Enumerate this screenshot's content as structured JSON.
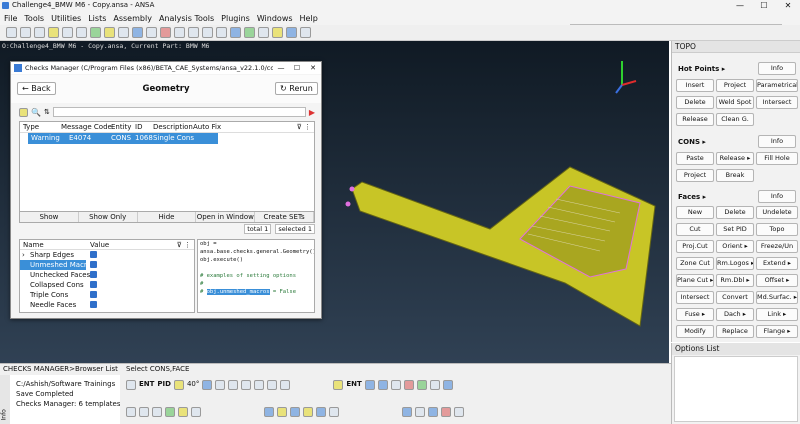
{
  "window": {
    "title": "Challenge4_BMW M6 - Copy.ansa - ANSA",
    "controls": [
      "—",
      "☐",
      "✕"
    ]
  },
  "menu": [
    "File",
    "Tools",
    "Utilities",
    "Lists",
    "Assembly",
    "Analysis Tools",
    "Plugins",
    "Windows",
    "Help"
  ],
  "status_path": "O:Challenge4_BMW M6 - Copy.ansa,  Current Part: BMW M6",
  "dialog": {
    "title": "Checks Manager (C/Program Files (x86)/BETA_CAE_Systems/ansa_v22.1.0/config/Checks/CFD_Temp...",
    "back_label": "Back",
    "heading": "Geometry",
    "rerun_label": "Rerun",
    "table": {
      "columns": [
        "Type",
        "Message Code",
        "Entity",
        "ID",
        "Description",
        "Auto Fix"
      ],
      "rows": [
        {
          "type": "Warning",
          "code": "E4074",
          "entity": "CONS",
          "id": "1068",
          "description": "Single Cons"
        }
      ]
    },
    "buttons": [
      "Show",
      "Show Only",
      "Hide",
      "Open in Window",
      "Create SETs"
    ],
    "totals": {
      "total": "total 1",
      "selected": "selected 1"
    },
    "list": {
      "name_header": "Name",
      "value_header": "Value",
      "items": [
        {
          "name": "Sharp Edges",
          "selected": false
        },
        {
          "name": "Unmeshed Macros",
          "selected": true
        },
        {
          "name": "Unchecked Faces",
          "selected": false
        },
        {
          "name": "Collapsed Cons",
          "selected": false
        },
        {
          "name": "Triple Cons",
          "selected": false
        },
        {
          "name": "Needle Faces",
          "selected": false
        }
      ]
    },
    "code": {
      "l1": "obj =",
      "l2": "ansa.base.checks.general.Geometry()",
      "l3": "obj.execute()",
      "l4": "# examples of setting options",
      "l5": "#",
      "l6a": "#",
      "l6b": "obj.unmeshed_macros",
      "l6c": " = False"
    }
  },
  "topo": {
    "title": "TOPO",
    "hotpoints": {
      "label": "Hot Points ▸",
      "buttons": [
        "Info",
        "Insert",
        "Project",
        "Parametrical",
        "Delete",
        "Weld Spot",
        "Intersect",
        "Release",
        "Clean G."
      ]
    },
    "cons": {
      "label": "CONS ▸",
      "buttons": [
        "Info",
        "Paste",
        "Release ▸",
        "Fill Hole",
        "Project",
        "Break"
      ]
    },
    "faces": {
      "label": "Faces ▸",
      "buttons": [
        "Info",
        "New",
        "Delete",
        "Undelete",
        "Cut",
        "Set PID",
        "Topo",
        "Proj.Cut",
        "Orient ▸",
        "Freeze/Un",
        "Zone Cut",
        "Rm.Logos ▸",
        "Extend ▸",
        "Plane Cut ▸",
        "Rm.Dbl ▸",
        "Offset ▸",
        "Intersect",
        "Convert",
        "Md.Surfac. ▸",
        "Fuse ▸",
        "Dach ▸",
        "Link ▸",
        "Modify",
        "Replace",
        "Flange ▸"
      ]
    }
  },
  "options_list": {
    "title": "Options List"
  },
  "console": {
    "header": "CHECKS MANAGER>Browser List",
    "side": "Info",
    "lines": [
      "C:/Ashish/Software Trainings",
      "Save Completed",
      "Checks Manager: 6 templates"
    ]
  },
  "bottom_toolbar": {
    "label": "Select CONS,FACE",
    "ent": "ENT",
    "pid": "PID",
    "angle": "40°",
    "ent2": "ENT"
  }
}
